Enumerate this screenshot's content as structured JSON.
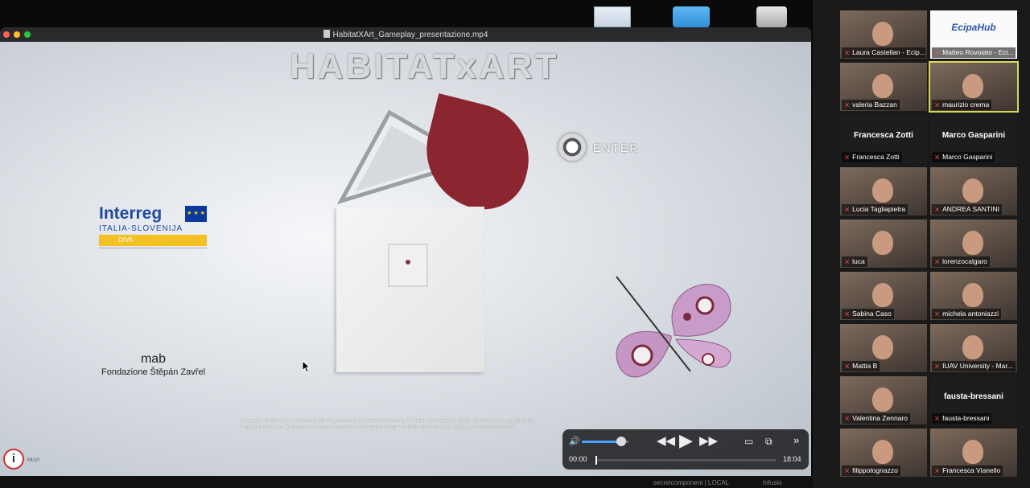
{
  "desktop": {
    "icons": [
      "document-icon",
      "folder-icon",
      "disk-icon"
    ]
  },
  "player": {
    "window_title": "HabitatXArt_Gameplay_presentazione.mp4",
    "game_title": "HABITATxART",
    "enter_label": "ENTER",
    "interreg": {
      "name": "Interreg",
      "country": "ITALIA-SLOVENIJA",
      "project": "DIVA"
    },
    "mab_logo": "mab",
    "foundation": "Fondazione Štěpán Zavřel",
    "credits_line1": "Il progetto Habitat X ArT è finanziato dal Programma di cooperazione Interreg V-A Italia Slovenia 2014-2020, nell'ambito del progetto DIVA.",
    "credits_line2": "Projekt Habitat X ArT je financiran s strani Programa sodelovanja Interreg V-A Italija Slovenija 2014 -2020, v okviru projekta DIVA.",
    "info_badge": "i",
    "muvi": "MUVI",
    "controls": {
      "time_current": "00:00",
      "time_total": "18:04",
      "volume_level": 0.85,
      "progress": 0.0
    }
  },
  "bottom_strip": {
    "text_1": "secretcomponent | LOCAL",
    "text_2": "Infusio"
  },
  "participants": [
    {
      "name": "Laura Castellan - Ecip...",
      "kind": "video",
      "muted": true
    },
    {
      "name": "Matteo Rovoiato - Eci...",
      "kind": "logo",
      "logo_text": "EcipaHub",
      "muted": true
    },
    {
      "name": "valeria Bazzan",
      "kind": "video",
      "muted": true
    },
    {
      "name": "maurizio crema",
      "kind": "video",
      "muted": true,
      "active": true
    },
    {
      "name": "Francesca Zotti",
      "kind": "blank",
      "display_name": "Francesca Zotti",
      "muted": true
    },
    {
      "name": "Marco Gasparini",
      "kind": "blank",
      "display_name": "Marco Gasparini",
      "muted": true
    },
    {
      "name": "Lucia Tagliapietra",
      "kind": "video",
      "muted": true
    },
    {
      "name": "ANDREA SANTINI",
      "kind": "video",
      "muted": true
    },
    {
      "name": "luca",
      "kind": "video",
      "muted": true
    },
    {
      "name": "lorenzocalgaro",
      "kind": "video",
      "muted": true
    },
    {
      "name": "Sabina Caso",
      "kind": "video",
      "muted": true
    },
    {
      "name": "michela antoniazzi",
      "kind": "video",
      "muted": true
    },
    {
      "name": "Mattia B",
      "kind": "video",
      "muted": true
    },
    {
      "name": "IUAV University - Mar...",
      "kind": "video",
      "muted": true
    },
    {
      "name": "Valentina Zennaro",
      "kind": "video",
      "muted": true
    },
    {
      "name": "fausta-bressani",
      "kind": "blank",
      "display_name": "fausta-bressani",
      "muted": true
    },
    {
      "name": "filippotognazzo",
      "kind": "video",
      "muted": true
    },
    {
      "name": "Francesca Vianello",
      "kind": "video",
      "muted": true
    }
  ]
}
